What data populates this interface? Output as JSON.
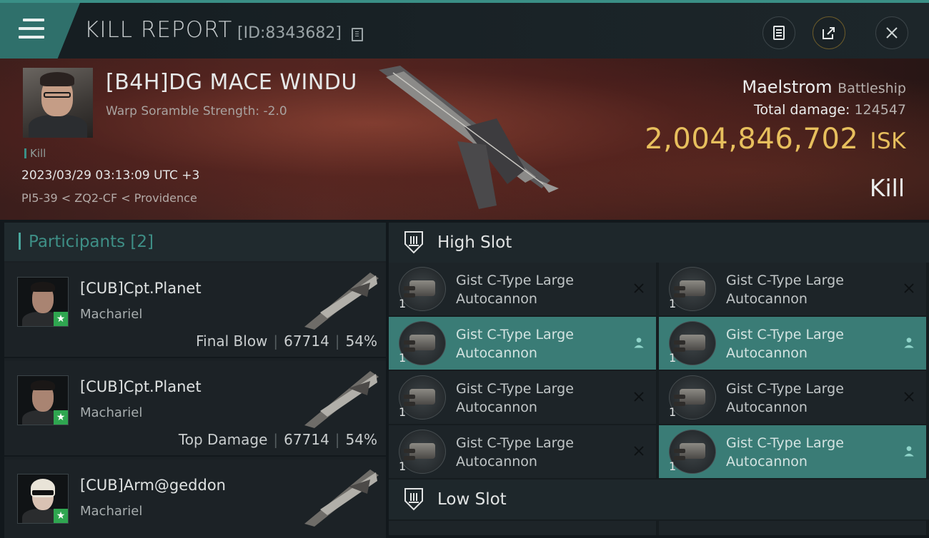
{
  "header": {
    "title": "KILL REPORT",
    "report_id": "[ID:8343682]",
    "icons": {
      "menu": "menu-icon",
      "copy": "copy-icon",
      "clipboard": "clipboard-icon",
      "share": "share-icon",
      "close": "close-icon"
    }
  },
  "victim": {
    "name": "[B4H]DG MACE WINDU",
    "subtitle": "Warp Soramble Strength: -2.0",
    "tag": "Kill",
    "datetime": "2023/03/29 03:13:09 UTC +3",
    "location": "PI5-39 < ZQ2-CF < Providence",
    "ship_name": "Maelstrom",
    "ship_class": "Battleship",
    "total_damage_label": "Total damage:",
    "total_damage": "124547",
    "isk_value": "2,004,846,702",
    "isk_unit": "ISK",
    "result": "Kill"
  },
  "participants": {
    "title": "Participants",
    "count": "[2]",
    "items": [
      {
        "name": "[CUB]Cpt.Planet",
        "ship": "Machariel",
        "role": "Final Blow",
        "damage": "67714",
        "percent": "54%"
      },
      {
        "name": "[CUB]Cpt.Planet",
        "ship": "Machariel",
        "role": "Top Damage",
        "damage": "67714",
        "percent": "54%"
      },
      {
        "name": "[CUB]Arm@geddon",
        "ship": "Machariel",
        "role": "",
        "damage": "",
        "percent": ""
      }
    ]
  },
  "slots": {
    "high": {
      "title": "High Slot",
      "modules": [
        {
          "line1": "Gist C-Type Large",
          "line2": "Autocannon",
          "qty": "1",
          "status": "destroyed"
        },
        {
          "line1": "Gist C-Type Large",
          "line2": "Autocannon",
          "qty": "1",
          "status": "destroyed"
        },
        {
          "line1": "Gist C-Type Large",
          "line2": "Autocannon",
          "qty": "1",
          "status": "dropped"
        },
        {
          "line1": "Gist C-Type Large",
          "line2": "Autocannon",
          "qty": "1",
          "status": "dropped"
        },
        {
          "line1": "Gist C-Type Large",
          "line2": "Autocannon",
          "qty": "1",
          "status": "destroyed"
        },
        {
          "line1": "Gist C-Type Large",
          "line2": "Autocannon",
          "qty": "1",
          "status": "destroyed"
        },
        {
          "line1": "Gist C-Type Large",
          "line2": "Autocannon",
          "qty": "1",
          "status": "destroyed"
        },
        {
          "line1": "Gist C-Type Large",
          "line2": "Autocannon",
          "qty": "1",
          "status": "dropped"
        }
      ]
    },
    "low": {
      "title": "Low Slot"
    }
  },
  "colors": {
    "accent": "#3a8f86",
    "isk": "#e7bf5d",
    "highlight_row": "#3a7c76"
  }
}
